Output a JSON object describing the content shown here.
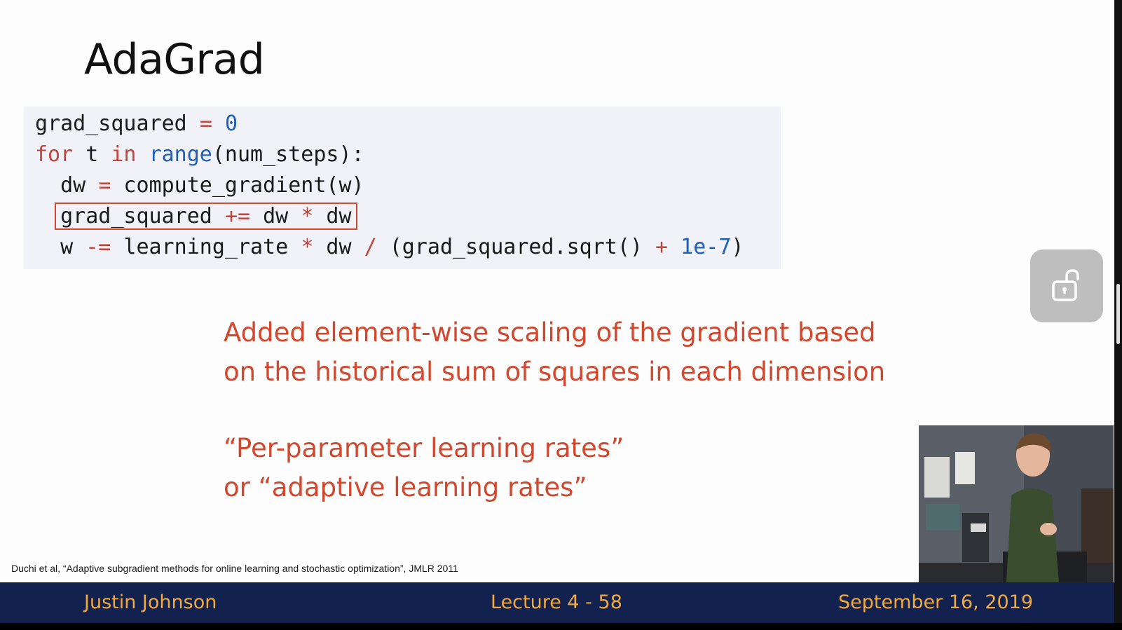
{
  "slide": {
    "title": "AdaGrad",
    "code": {
      "line1": {
        "a": "grad_squared ",
        "op": "=",
        "b": " ",
        "num": "0"
      },
      "line2": {
        "kw1": "for",
        "a": " t ",
        "kw2": "in",
        "b": " ",
        "fn": "range",
        "c": "(num_steps):"
      },
      "line3": {
        "indent": "  ",
        "a": "dw ",
        "op": "=",
        "b": " compute_gradient(w)"
      },
      "line4": {
        "indent": "  ",
        "a": "grad_squared ",
        "op1": "+=",
        "b": " dw ",
        "op2": "*",
        "c": " dw"
      },
      "line5": {
        "indent": "  ",
        "a": "w ",
        "op1": "-=",
        "b": " learning_rate ",
        "op2": "*",
        "c": " dw ",
        "op3": "/",
        "d": " (grad_squared.sqrt() ",
        "op4": "+",
        "e": " ",
        "num": "1e-7",
        "f": ")"
      }
    },
    "explanation": {
      "line1": "Added element-wise scaling of the gradient based",
      "line2": "on the historical sum of squares in each dimension"
    },
    "quote": {
      "line1": "“Per-parameter learning rates”",
      "line2": "or “adaptive learning rates”"
    },
    "citation": "Duchi et al, “Adaptive subgradient methods for online learning and stochastic optimization”, JMLR 2011",
    "footer": {
      "author": "Justin Johnson",
      "lecture": "Lecture 4 - 58",
      "date": "September 16, 2019"
    }
  },
  "controls": {
    "lock_icon": "unlock-icon"
  },
  "colors": {
    "accent_red": "#d2482e",
    "footer_bg": "#13214f",
    "footer_text": "#f2a93b",
    "code_bg": "#f0f2f7",
    "code_blue": "#1f5fb8"
  }
}
